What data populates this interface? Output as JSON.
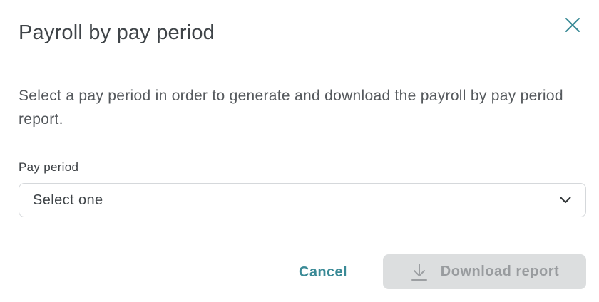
{
  "dialog": {
    "title": "Payroll by pay period",
    "close_icon": "close-icon",
    "description": "Select a pay period in order to generate and download the payroll by pay period report."
  },
  "pay_period": {
    "label": "Pay period",
    "selected_value": "Select one",
    "chevron_icon": "chevron-down-icon"
  },
  "actions": {
    "cancel_label": "Cancel",
    "download_label": "Download report",
    "download_icon": "download-icon",
    "download_disabled": true
  },
  "colors": {
    "accent": "#3a8a96",
    "disabled_bg": "#dcdedf",
    "disabled_text": "#999c9f",
    "text": "#3f4448"
  }
}
